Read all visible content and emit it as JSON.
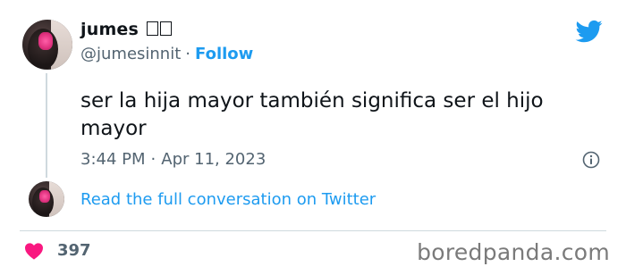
{
  "tweet": {
    "author_name": "jumes",
    "author_name_suffix": "",
    "handle": "@jumesinnit",
    "separator": "·",
    "follow_label": "Follow",
    "text_line1": "ser la hija mayor también significa ser el hijo",
    "text_line2": "mayor",
    "time": "3:44 PM",
    "date": "Apr 11, 2023"
  },
  "footer": {
    "read_full_label": "Read the full conversation on Twitter",
    "like_count": "397"
  },
  "watermark": "boredpanda.com",
  "icons": {
    "brand": "twitter-bird-icon",
    "info": "info-icon",
    "like": "heart-icon"
  },
  "colors": {
    "accent": "#1d9bf0",
    "heart": "#f91880",
    "muted_text": "#536471",
    "text": "#0f1419"
  }
}
